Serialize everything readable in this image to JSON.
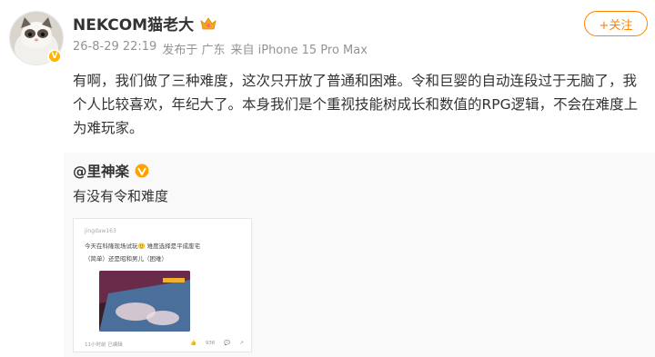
{
  "author": {
    "name": "NEKCOM猫老大",
    "avatar_icon": "cat-avatar-icon",
    "vip_icon": "crown-icon"
  },
  "meta": {
    "date": "26-8-29 22:19",
    "location": "发布于 广东",
    "device": "来自 iPhone 15 Pro Max"
  },
  "follow_button": "+关注",
  "post": {
    "text": "有啊，我们做了三种难度，这次只开放了普通和困难。令和巨婴的自动连段过于无脑了，我个人比较喜欢，年纪大了。本身我们是个重视技能树成长和数值的RPG逻辑，不会在难度上为难玩家。"
  },
  "repost": {
    "author": "@里神楽",
    "author_badge_icon": "gold-badge-icon",
    "text": "有没有令和难度",
    "image": {
      "username": "jingdaw163",
      "line1": "今天在科隆现场试玩🙂 难度选择是平成废宅",
      "line2": "（简单）还是昭和男儿（困难）",
      "footer_left": "11小时前 已编辑",
      "likes": "936",
      "like_icon": "thumb-up-icon",
      "comment_icon": "comment-icon",
      "share_icon": "share-icon"
    }
  },
  "colors": {
    "accent": "#ff8200",
    "meta_text": "#939393",
    "repost_bg": "#f9f9f9"
  }
}
